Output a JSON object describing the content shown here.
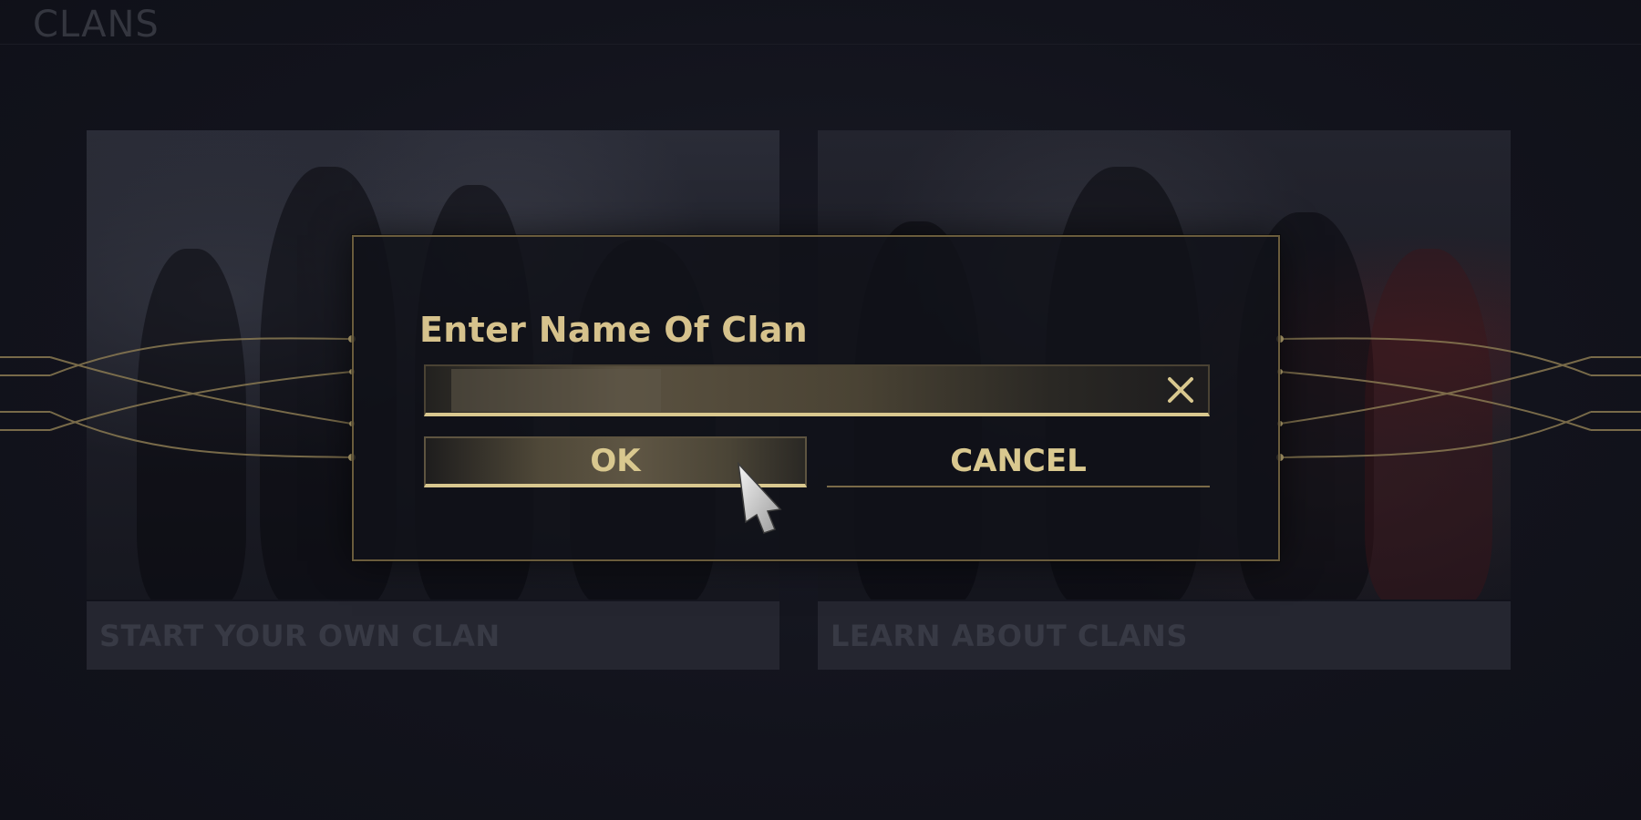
{
  "page": {
    "title": "CLANS"
  },
  "cards": [
    {
      "label": "START YOUR OWN CLAN"
    },
    {
      "label": "LEARN ABOUT CLANS"
    }
  ],
  "dialog": {
    "title": "Enter Name Of Clan",
    "input_value": "",
    "input_placeholder": "",
    "clear_icon": "close-icon",
    "ok_label": "OK",
    "cancel_label": "CANCEL"
  },
  "colors": {
    "accent_gold": "#d9c88f",
    "background": "#12131c",
    "card_label_bg": "#252630"
  }
}
